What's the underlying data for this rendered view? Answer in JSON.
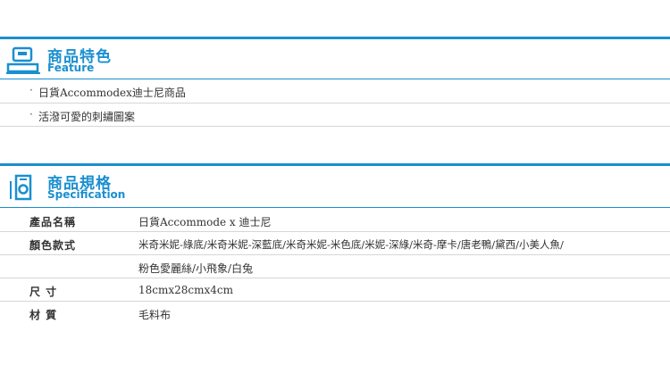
{
  "feature": {
    "title": "商品特色",
    "subtitle": "Feature",
    "icon": "register-icon",
    "items": [
      "日貨Accommodex迪士尼商品",
      "活潑可愛的刺繡圖案"
    ]
  },
  "spec": {
    "title": "商品規格",
    "subtitle": "Specification",
    "icon": "phone-icon",
    "rows": [
      {
        "label": "產品名稱",
        "value": "日貨Accommode x 迪士尼"
      },
      {
        "label": "顏色款式",
        "value": "米奇米妮-綠底/米奇米妮-深藍底/米奇米妮-米色底/米妮-深綠/米奇-摩卡/唐老鴨/黛西/小美人魚/"
      },
      {
        "label": "",
        "value": "粉色愛麗絲/小飛象/白兔"
      },
      {
        "label": "尺 寸",
        "value": "18cmx28cmx4cm"
      },
      {
        "label": "材 質",
        "value": "毛料布"
      }
    ]
  },
  "colors": {
    "accent": "#1a8fd0",
    "divider": "#d6d6d6"
  }
}
